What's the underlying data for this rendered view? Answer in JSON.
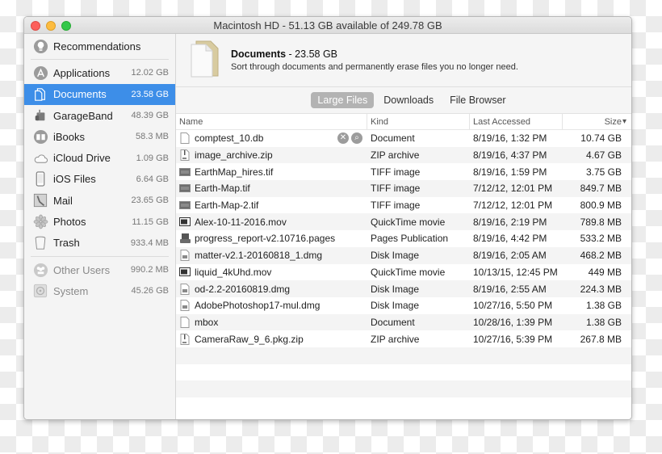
{
  "window": {
    "title": "Macintosh HD - 51.13 GB available of 249.78 GB"
  },
  "sidebar": {
    "items": [
      {
        "label": "Recommendations",
        "size": "",
        "icon": "lightbulb-icon"
      },
      {
        "label": "Applications",
        "size": "12.02 GB",
        "icon": "app-store-icon"
      },
      {
        "label": "Documents",
        "size": "23.58 GB",
        "icon": "documents-icon",
        "active": true
      },
      {
        "label": "GarageBand",
        "size": "48.39 GB",
        "icon": "garageband-icon"
      },
      {
        "label": "iBooks",
        "size": "58.3 MB",
        "icon": "ibooks-icon"
      },
      {
        "label": "iCloud Drive",
        "size": "1.09 GB",
        "icon": "cloud-icon"
      },
      {
        "label": "iOS Files",
        "size": "6.64 GB",
        "icon": "iphone-icon"
      },
      {
        "label": "Mail",
        "size": "23.65 GB",
        "icon": "mail-icon"
      },
      {
        "label": "Photos",
        "size": "11.15 GB",
        "icon": "photos-icon"
      },
      {
        "label": "Trash",
        "size": "933.4 MB",
        "icon": "trash-icon"
      },
      {
        "label": "Other Users",
        "size": "990.2 MB",
        "icon": "users-icon"
      },
      {
        "label": "System",
        "size": "45.26 GB",
        "icon": "system-icon"
      }
    ]
  },
  "header": {
    "title": "Documents",
    "size": " - 23.58 GB",
    "subtitle": "Sort through documents and permanently erase files you no longer need."
  },
  "tabs": [
    {
      "label": "Large Files",
      "active": true
    },
    {
      "label": "Downloads"
    },
    {
      "label": "File Browser"
    }
  ],
  "table": {
    "columns": {
      "name": "Name",
      "kind": "Kind",
      "date": "Last Accessed",
      "size": "Size",
      "sort_indicator": "⌄"
    },
    "rows": [
      {
        "name": "comptest_10.db",
        "kind": "Document",
        "date": "8/19/16, 1:32 PM",
        "size": "10.74 GB",
        "icon": "document-icon"
      },
      {
        "name": "image_archive.zip",
        "kind": "ZIP archive",
        "date": "8/19/16, 4:37 PM",
        "size": "4.67 GB",
        "icon": "zip-icon"
      },
      {
        "name": "EarthMap_hires.tif",
        "kind": "TIFF image",
        "date": "8/19/16, 1:59 PM",
        "size": "3.75 GB",
        "icon": "image-icon"
      },
      {
        "name": "Earth-Map.tif",
        "kind": "TIFF image",
        "date": "7/12/12, 12:01 PM",
        "size": "849.7 MB",
        "icon": "image-icon"
      },
      {
        "name": "Earth-Map-2.tif",
        "kind": "TIFF image",
        "date": "7/12/12, 12:01 PM",
        "size": "800.9 MB",
        "icon": "image-icon"
      },
      {
        "name": "Alex-10-11-2016.mov",
        "kind": "QuickTime movie",
        "date": "8/19/16, 2:19 PM",
        "size": "789.8 MB",
        "icon": "movie-icon"
      },
      {
        "name": "progress_report-v2.10716.pages",
        "kind": "Pages Publication",
        "date": "8/19/16, 4:42 PM",
        "size": "533.2 MB",
        "icon": "pages-icon"
      },
      {
        "name": "matter-v2.1-20160818_1.dmg",
        "kind": "Disk Image",
        "date": "8/19/16, 2:05 AM",
        "size": "468.2 MB",
        "icon": "disk-image-icon"
      },
      {
        "name": "liquid_4kUhd.mov",
        "kind": "QuickTime movie",
        "date": "10/13/15, 12:45 PM",
        "size": "449 MB",
        "icon": "movie-icon"
      },
      {
        "name": "od-2.2-20160819.dmg",
        "kind": "Disk Image",
        "date": "8/19/16, 2:55 AM",
        "size": "224.3 MB",
        "icon": "disk-image-icon"
      },
      {
        "name": "AdobePhotoshop17-mul.dmg",
        "kind": "Disk Image",
        "date": "10/27/16, 5:50 PM",
        "size": "1.38 GB",
        "icon": "disk-image-icon"
      },
      {
        "name": "mbox",
        "kind": "Document",
        "date": "10/28/16, 1:39 PM",
        "size": "1.38 GB",
        "icon": "document-icon"
      },
      {
        "name": "CameraRaw_9_6.pkg.zip",
        "kind": "ZIP archive",
        "date": "10/27/16, 5:39 PM",
        "size": "267.8 MB",
        "icon": "zip-icon"
      }
    ],
    "row_actions": {
      "delete": "✕",
      "reveal": "⌕"
    }
  },
  "colors": {
    "accent": "#3d8ee8",
    "active_tab": "#b3b3b3"
  }
}
